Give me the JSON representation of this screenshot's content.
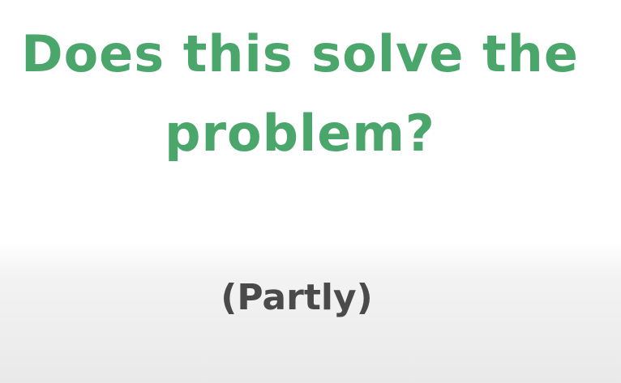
{
  "slide": {
    "headline": "Does this solve the problem?",
    "subtext": "(Partly)",
    "colors": {
      "headline": "#4aa66a",
      "subtext": "#4a4a4a",
      "background": "#ffffff"
    }
  }
}
